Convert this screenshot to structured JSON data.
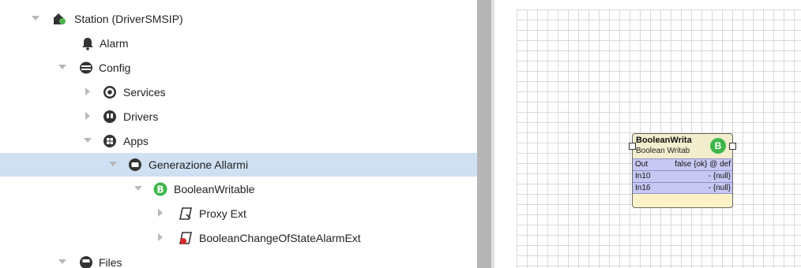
{
  "tree": {
    "items": [
      {
        "label": "Station (DriverSMSIP)",
        "icon": "station-icon"
      },
      {
        "label": "Alarm",
        "icon": "bell-icon"
      },
      {
        "label": "Config",
        "icon": "database-icon"
      },
      {
        "label": "Services",
        "icon": "services-icon"
      },
      {
        "label": "Drivers",
        "icon": "drivers-icon"
      },
      {
        "label": "Apps",
        "icon": "apps-icon"
      },
      {
        "label": "Generazione Allarmi",
        "icon": "folder-icon"
      },
      {
        "label": "BooleanWritable",
        "icon": "boolean-point-icon"
      },
      {
        "label": "Proxy Ext",
        "icon": "proxy-ext-icon"
      },
      {
        "label": "BooleanChangeOfStateAlarmExt",
        "icon": "alarm-ext-icon"
      },
      {
        "label": "Files",
        "icon": "files-icon"
      }
    ]
  },
  "wiresheet": {
    "block": {
      "title": "BooleanWrita",
      "subtitle": "Boolean Writab",
      "badge": "B",
      "slots": [
        {
          "name": "Out",
          "value": "false {ok} @ def"
        },
        {
          "name": "In10",
          "value": "- {null}"
        },
        {
          "name": "In16",
          "value": "- {null}"
        }
      ]
    }
  },
  "colors": {
    "selection": "#cfe0f3",
    "badge_green": "#3fb64b",
    "slot_background": "#c8c8f4",
    "block_header": "#f2eecd",
    "grid_line": "#d9d9d9"
  }
}
